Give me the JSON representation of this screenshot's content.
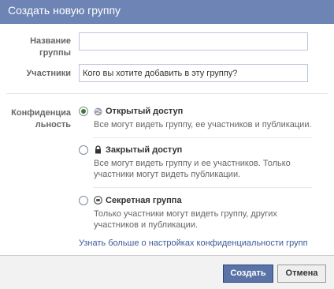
{
  "dialog": {
    "title": "Создать новую группу"
  },
  "form": {
    "name_label_line1": "Название",
    "name_label_line2": "группы",
    "name_value": "",
    "members_label": "Участники",
    "members_placeholder": "Кого вы хотите добавить в эту группу?",
    "privacy_label_line1": "Конфиденциа",
    "privacy_label_line2": "льность"
  },
  "privacy_options": [
    {
      "title": "Открытый доступ",
      "icon": "globe-icon",
      "description": [
        "Все могут видеть группу, ее участников и публикации."
      ],
      "selected": true
    },
    {
      "title": "Закрытый доступ",
      "icon": "lock-icon",
      "description": [
        "Все могут видеть группу и ее участников. Только",
        "участники могут видеть публикации."
      ],
      "selected": false
    },
    {
      "title": "Секретная группа",
      "icon": "secret-icon",
      "description": [
        "Только участники могут видеть группу, других",
        "участников и публикации."
      ],
      "selected": false
    }
  ],
  "learn_more_link": "Узнать больше о настройках конфиденциальности групп",
  "buttons": {
    "create": "Создать",
    "cancel": "Отмена"
  },
  "colors": {
    "header": "#6d84b4",
    "link": "#3b5998",
    "primary_button": "#5b74a8"
  }
}
